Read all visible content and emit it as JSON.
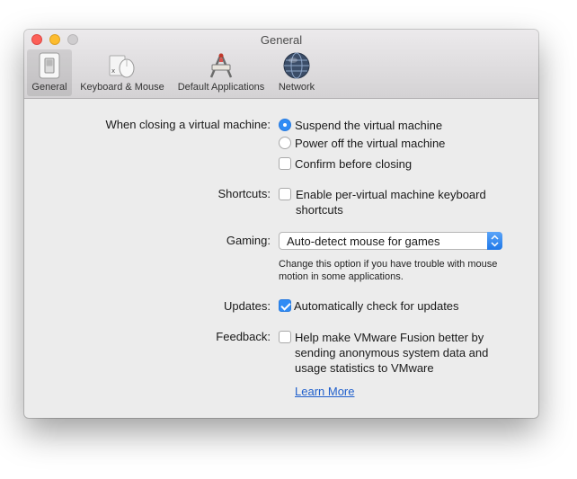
{
  "window": {
    "title": "General"
  },
  "toolbar": {
    "items": [
      {
        "label": "General",
        "icon": "general-switch-icon",
        "selected": true
      },
      {
        "label": "Keyboard & Mouse",
        "icon": "keyboard-mouse-icon",
        "selected": false
      },
      {
        "label": "Default Applications",
        "icon": "default-applications-icon",
        "selected": false
      },
      {
        "label": "Network",
        "icon": "network-globe-icon",
        "selected": false
      }
    ]
  },
  "closing": {
    "label": "When closing a virtual machine:",
    "suspend_label": "Suspend the virtual machine",
    "suspend_selected": true,
    "poweroff_label": "Power off the virtual machine",
    "poweroff_selected": false,
    "confirm_label": "Confirm before closing",
    "confirm_checked": false
  },
  "shortcuts": {
    "label": "Shortcuts:",
    "option_line1": "Enable per-virtual machine keyboard",
    "option_line2": "shortcuts",
    "checked": false
  },
  "gaming": {
    "label": "Gaming:",
    "selected_value": "Auto-detect mouse for games",
    "hint_line1": "Change this option if you have trouble with mouse",
    "hint_line2": "motion in some applications."
  },
  "updates": {
    "label": "Updates:",
    "option": "Automatically check for updates",
    "checked": true
  },
  "feedback": {
    "label": "Feedback:",
    "option_line1": "Help make VMware Fusion better by",
    "option_line2": "sending anonymous system data and",
    "option_line3": "usage statistics to VMware",
    "checked": false,
    "learn_more": "Learn More"
  },
  "colors": {
    "accent": "#2f8cf5",
    "link": "#1f5fcc",
    "window_bg": "#ececec",
    "close": "#fc5f57",
    "minimize": "#fdbc2e"
  }
}
